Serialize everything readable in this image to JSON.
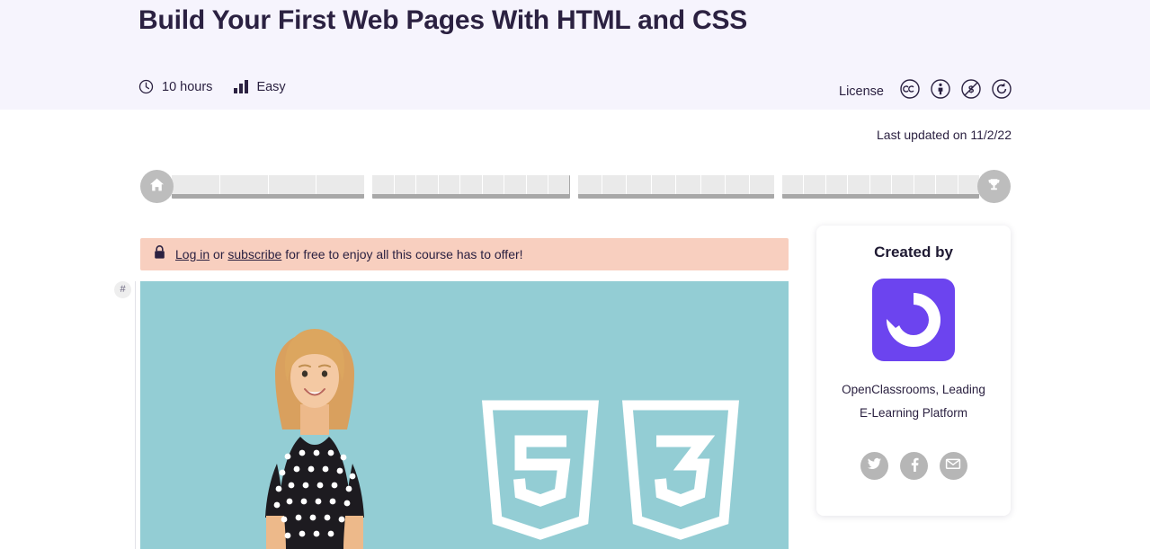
{
  "header": {
    "title": "Build Your First Web Pages With HTML and CSS",
    "duration": "10 hours",
    "duration_icon": "clock-icon",
    "difficulty": "Easy",
    "difficulty_icon": "difficulty-bars-icon",
    "license_label": "License",
    "license_icons": [
      {
        "name": "creative-commons-icon",
        "label": "CC"
      },
      {
        "name": "cc-by-attribution-icon",
        "label": "BY"
      },
      {
        "name": "cc-nc-noncommercial-icon",
        "label": "NC"
      },
      {
        "name": "cc-sa-sharealike-icon",
        "label": "SA"
      }
    ],
    "background_color": "#f6f4fd"
  },
  "meta": {
    "last_updated": "Last updated on 11/2/22"
  },
  "progress": {
    "start_icon": "home-icon",
    "end_icon": "trophy-icon",
    "groups": [
      4,
      9,
      8,
      9
    ],
    "completed": 0,
    "track_color": "#eaeaea",
    "rail_color": "#a8a8a8"
  },
  "alert": {
    "icon": "lock-icon",
    "login_link": "Log in",
    "conjunction": " or ",
    "subscribe_link": "subscribe",
    "suffix": " for free to enjoy all this course has to offer!",
    "background_color": "#f8cfbf"
  },
  "anchor": {
    "symbol": "#"
  },
  "hero": {
    "background_color": "#93cdd4",
    "alt": "Instructor with HTML5 and CSS3 shield logos",
    "logos": [
      {
        "name": "html5-shield-icon",
        "label": "5"
      },
      {
        "name": "css3-shield-icon",
        "label": "3"
      }
    ]
  },
  "sidebar": {
    "created_by_heading": "Created by",
    "brand_logo_name": "openclassrooms-logo",
    "brand_color": "#6c44ef",
    "author_line_1": "OpenClassrooms, Leading",
    "author_line_2": "E-Learning Platform",
    "social": [
      {
        "name": "twitter-icon",
        "label": "Twitter"
      },
      {
        "name": "facebook-icon",
        "label": "Facebook"
      },
      {
        "name": "email-icon",
        "label": "Email"
      }
    ]
  }
}
